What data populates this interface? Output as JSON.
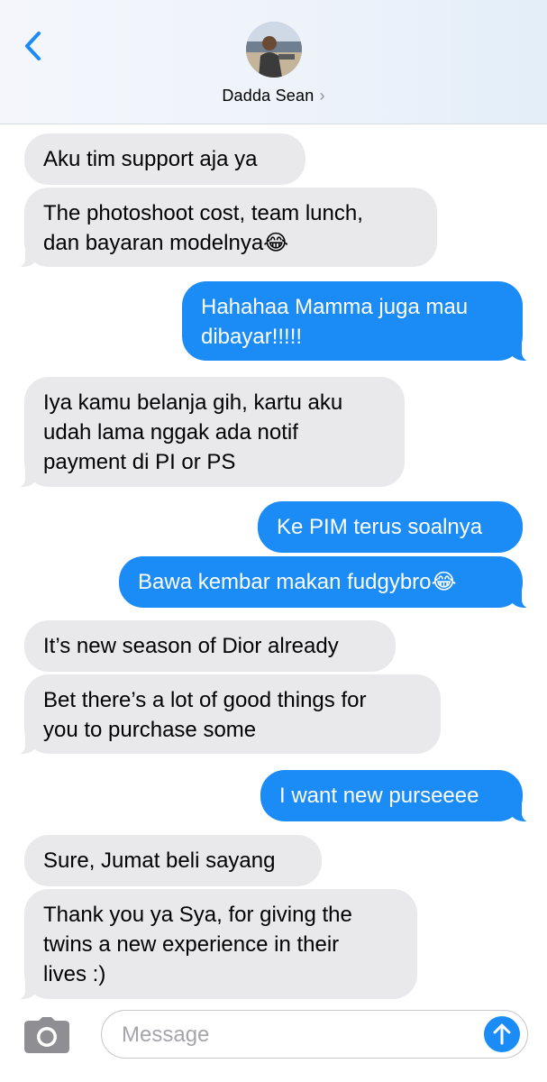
{
  "header": {
    "contact_name": "Dadda Sean",
    "chevron": "›",
    "back_icon": "chevron-left-icon"
  },
  "messages": [
    {
      "side": "incoming",
      "text": [
        "Aku tim support aja ya"
      ]
    },
    {
      "side": "incoming",
      "text": [
        "The photoshoot cost, team lunch,",
        "dan bayaran modelnya😂"
      ]
    },
    {
      "side": "outgoing",
      "text": [
        "Hahahaa Mamma juga mau",
        "dibayar!!!!!"
      ]
    },
    {
      "side": "incoming",
      "text": [
        "Iya kamu belanja gih, kartu aku",
        "udah lama nggak ada notif",
        "payment di PI or PS"
      ]
    },
    {
      "side": "outgoing",
      "text": [
        "Ke PIM terus soalnya"
      ]
    },
    {
      "side": "outgoing",
      "text": [
        "Bawa kembar makan fudgybro😂"
      ]
    },
    {
      "side": "incoming",
      "text": [
        "It’s new season of Dior already"
      ]
    },
    {
      "side": "incoming",
      "text": [
        "Bet there’s a lot of good things for",
        "you to purchase some"
      ]
    },
    {
      "side": "outgoing",
      "text": [
        "I want new purseeee"
      ]
    },
    {
      "side": "incoming",
      "text": [
        "Sure, Jumat beli sayang"
      ]
    },
    {
      "side": "incoming",
      "text": [
        "Thank you ya Sya, for giving the",
        "twins a new experience in their",
        "lives :)"
      ]
    }
  ],
  "composer": {
    "placeholder": "Message",
    "value": "",
    "camera_icon": "camera-icon",
    "send_icon": "arrow-up-icon"
  },
  "colors": {
    "incoming_bubble": "#e9e9eb",
    "outgoing_bubble": "#1b8cf6",
    "accent": "#1b8cf6"
  }
}
